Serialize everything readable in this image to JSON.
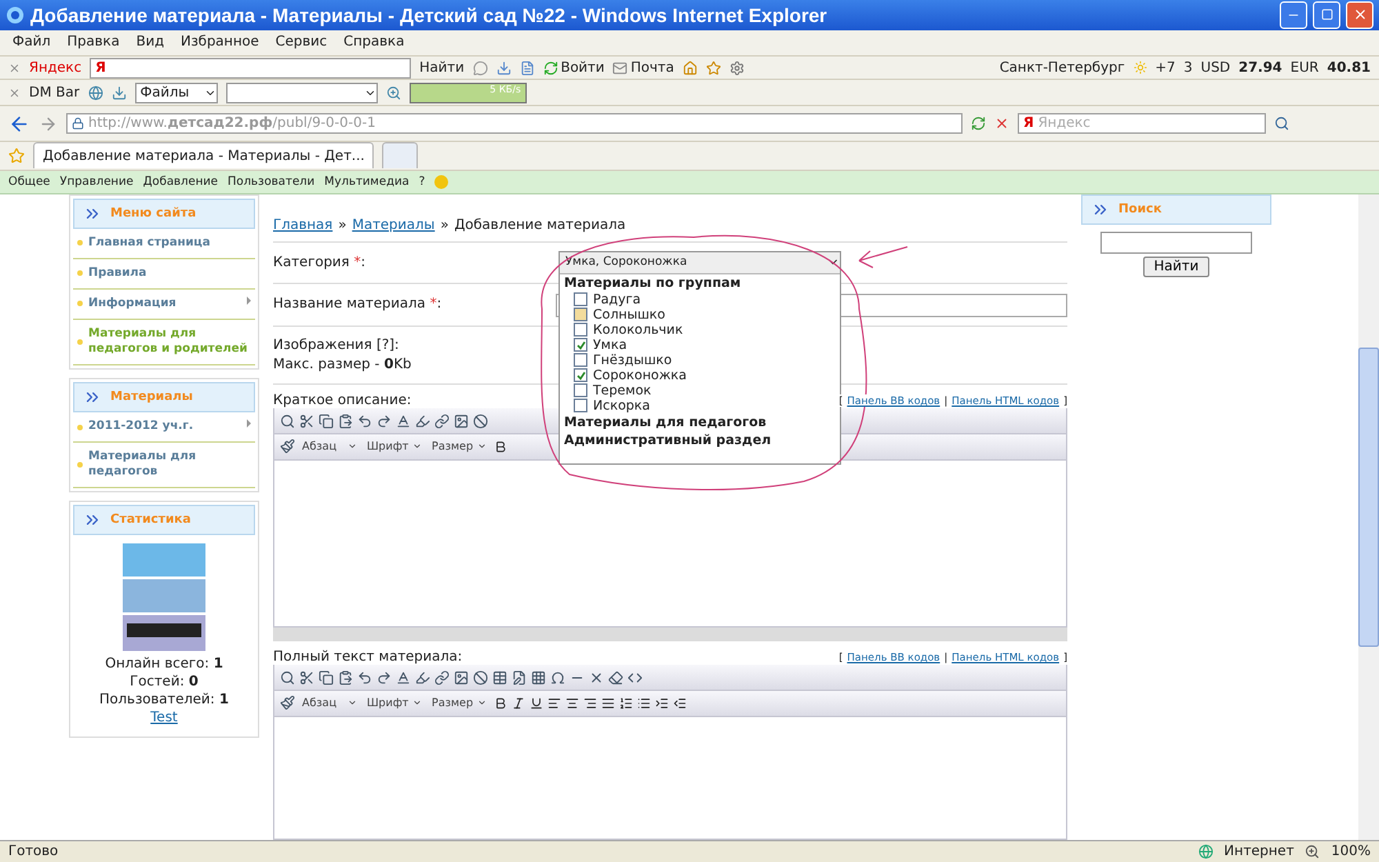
{
  "window": {
    "title": "Добавление материала - Материалы - Детский сад №22 - Windows Internet Explorer"
  },
  "menu": [
    "Файл",
    "Правка",
    "Вид",
    "Избранное",
    "Сервис",
    "Справка"
  ],
  "yandex_bar": {
    "brand": "Яндекс",
    "search_logo": "Я",
    "search_button": "Найти",
    "login": "Войти",
    "mail": "Почта",
    "city": "Санкт-Петербург",
    "temperature": "+7",
    "traffic": "3",
    "usd_label": "USD",
    "usd": "27.94",
    "eur_label": "EUR",
    "eur": "40.81"
  },
  "dm_bar": {
    "name": "DM Bar",
    "files": "Файлы",
    "speed": "5 КБ/s"
  },
  "address_bar": {
    "url": "http://www.**детсад22.рф**/publ/9-0-0-0-1",
    "search_logo": "Я",
    "search_placeholder": "Яндекс"
  },
  "tabs": [
    {
      "label": "Добавление материала - Материалы - Дет...",
      "selected": true
    }
  ],
  "admin_bar": {
    "items": [
      "Общее",
      "Управление",
      "Добавление",
      "Пользователи",
      "Мультимедиа",
      "?"
    ]
  },
  "sidebar": {
    "blocks": [
      {
        "title": "Меню сайта",
        "items": [
          {
            "label": "Главная страница",
            "selected": false,
            "expandable": false
          },
          {
            "label": "Правила",
            "selected": false,
            "expandable": false
          },
          {
            "label": "Информация",
            "selected": false,
            "expandable": true
          },
          {
            "label": "Материалы для педагогов и родителей",
            "selected": true,
            "expandable": false
          }
        ]
      },
      {
        "title": "Материалы",
        "items": [
          {
            "label": "2011-2012 уч.г.",
            "selected": false,
            "expandable": true
          },
          {
            "label": "Материалы для педагогов",
            "selected": false,
            "expandable": false
          }
        ]
      },
      {
        "title": "Статистика",
        "stats": [
          {
            "label": "Онлайн всего:",
            "value": "1"
          },
          {
            "label": "Гостей:",
            "value": "0"
          },
          {
            "label": "Пользователей:",
            "value": "1"
          }
        ],
        "user": "Test"
      }
    ]
  },
  "breadcrumb": {
    "links": [
      "Главная",
      "Материалы"
    ],
    "separator": "»",
    "current": "Добавление материала"
  },
  "form": {
    "category": {
      "label": "Категория",
      "mark": "*",
      "end": ":",
      "value": "Умка, Сороконожка"
    },
    "title": {
      "label": "Название материала",
      "mark": "*",
      "end": ":"
    },
    "images": {
      "label": "Изображения [?]:",
      "max_size": "Макс. размер - **0**Kb"
    }
  },
  "dropdown": {
    "groups": [
      {
        "title": "Материалы по группам",
        "items": [
          {
            "label": "Радуга",
            "checked": false,
            "hovered": false
          },
          {
            "label": "Солнышко",
            "checked": false,
            "hovered": true
          },
          {
            "label": "Колокольчик",
            "checked": false,
            "hovered": false
          },
          {
            "label": "Умка",
            "checked": true,
            "hovered": false
          },
          {
            "label": "Гнёздышко",
            "checked": false,
            "hovered": false
          },
          {
            "label": "Сороконожка",
            "checked": true,
            "hovered": false
          },
          {
            "label": "Теремок",
            "checked": false,
            "hovered": false
          },
          {
            "label": "Искорка",
            "checked": false,
            "hovered": false
          }
        ]
      },
      {
        "title": "Материалы для педагогов"
      },
      {
        "title": "Административный раздел"
      }
    ]
  },
  "editors": [
    {
      "label": "Краткое описание:",
      "bracket_open": "[",
      "divider": "|",
      "bracket_close": "]",
      "links": [
        "Панель BB кодов",
        "Панель HTML кодов"
      ],
      "paragraph": "Абзац",
      "font": "Шрифт",
      "size": "Размер"
    },
    {
      "label": "Полный текст материала:",
      "bracket_open": "[",
      "divider": "|",
      "bracket_close": "]",
      "links": [
        "Панель BB кодов",
        "Панель HTML кодов"
      ],
      "paragraph": "Абзац",
      "font": "Шрифт",
      "size": "Размер"
    }
  ],
  "search": {
    "title": "Поиск",
    "button": "Найти"
  },
  "status_bar": {
    "text": "Готово",
    "zone": "Интернет",
    "zoom": "100%"
  }
}
